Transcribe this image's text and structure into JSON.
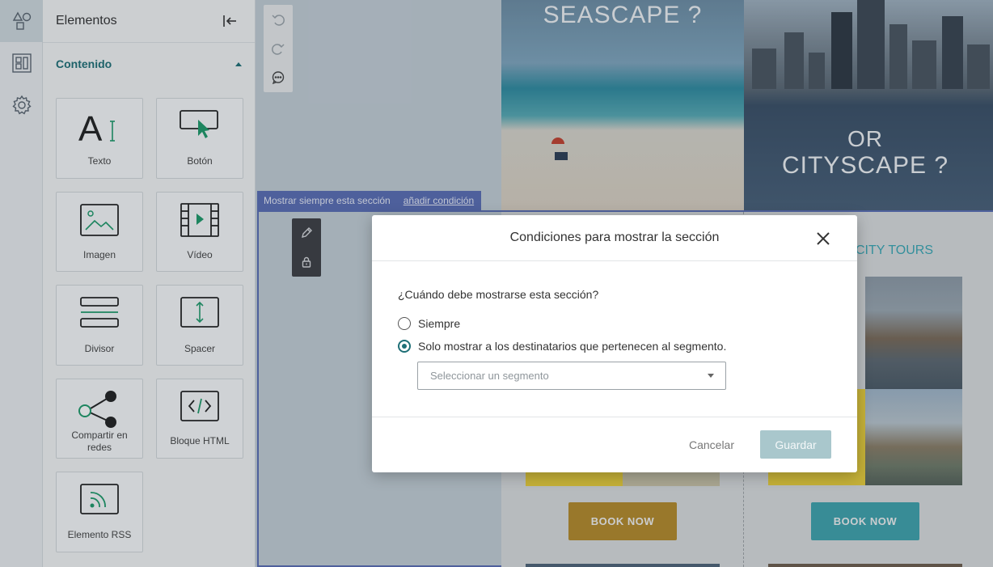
{
  "sidebar": {
    "rail": [
      "elements-icon",
      "layout-icon",
      "settings-icon"
    ],
    "panel_title": "Elementos",
    "section_title": "Contenido",
    "tiles": [
      {
        "label": "Texto",
        "icon": "text-icon"
      },
      {
        "label": "Botón",
        "icon": "button-icon"
      },
      {
        "label": "Imagen",
        "icon": "image-icon"
      },
      {
        "label": "Vídeo",
        "icon": "video-icon"
      },
      {
        "label": "Divisor",
        "icon": "divider-icon"
      },
      {
        "label": "Spacer",
        "icon": "spacer-icon"
      },
      {
        "label": "Compartir en redes",
        "icon": "share-icon"
      },
      {
        "label": "Bloque HTML",
        "icon": "html-icon"
      },
      {
        "label": "Elemento RSS",
        "icon": "rss-icon"
      }
    ]
  },
  "canvas": {
    "hero_left_text": "SEASCAPE ?",
    "hero_right_text_1": "OR",
    "hero_right_text_2": "CITYSCAPE ?",
    "section_bar_label": "Mostrar siempre esta sección",
    "section_bar_link": "añadir condición",
    "city_tours": "CITY TOURS",
    "book_now_left": "BOOK NOW",
    "book_now_right": "BOOK NOW",
    "colors": {
      "book_left": "#b58a2a",
      "book_right": "#3fa3ad",
      "section_accent": "#5a6db4",
      "yellow_block": "#e9cf3a"
    }
  },
  "modal": {
    "title": "Condiciones para mostrar la sección",
    "question": "¿Cuándo debe mostrarse esta sección?",
    "option_always": "Siempre",
    "option_segment": "Solo mostrar a los destinatarios que pertenecen al segmento.",
    "selected_option": "segment",
    "select_placeholder": "Seleccionar un segmento",
    "cancel": "Cancelar",
    "save": "Guardar"
  }
}
